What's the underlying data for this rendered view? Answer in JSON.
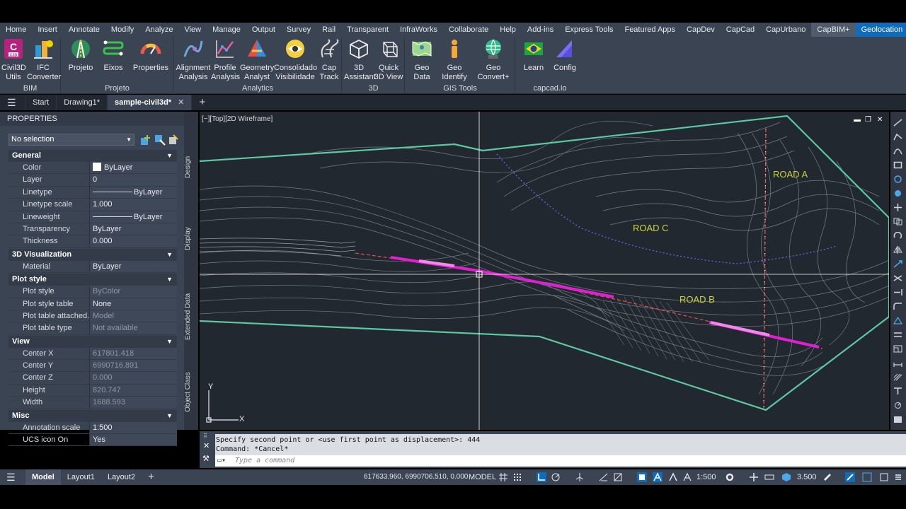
{
  "menus": [
    "Home",
    "Insert",
    "Annotate",
    "Modify",
    "Analyze",
    "View",
    "Manage",
    "Output",
    "Survey",
    "Rail",
    "Transparent",
    "InfraWorks",
    "Collaborate",
    "Help",
    "Add-ins",
    "Express Tools",
    "Featured Apps",
    "CapDev",
    "CapCad",
    "CapUrbano",
    "CapBIM+",
    "Geolocation"
  ],
  "ribbon": {
    "groups": {
      "bim": "BIM",
      "projeto": "Projeto",
      "analytics": "Analytics",
      "d3": "3D",
      "gis": "GIS Tools",
      "capcad": "capcad.io"
    },
    "buttons": {
      "civil3d": "Civil3D Utils",
      "civil3d_l1": "Civil3D",
      "civil3d_l2": "Utils",
      "ifc_l1": "IFC",
      "ifc_l2": "Converter",
      "projeto": "Projeto",
      "eixos": "Eixos",
      "properties": "Properties",
      "alignment_l1": "Alignment",
      "alignment_l2": "Analysis",
      "profile_l1": "Profile",
      "profile_l2": "Analysis",
      "geometry_l1": "Geometry",
      "geometry_l2": "Analyst",
      "consolidado_l1": "Consolidado",
      "consolidado_l2": "Visibilidade",
      "cap_l1": "Cap",
      "cap_l2": "Track",
      "assistant_l1": "3D",
      "assistant_l2": "Assistant",
      "quick_l1": "Quick",
      "quick_l2": "3D View",
      "geodata_l1": "Geo",
      "geodata_l2": "Data",
      "geoidentify_l1": "Geo",
      "geoidentify_l2": "Identify",
      "geoconvert_l1": "Geo",
      "geoconvert_l2": "Convert+",
      "learn": "Learn",
      "config": "Config",
      "c3d_badge": "C3D"
    }
  },
  "doc_tabs": {
    "start": "Start",
    "drawing1": "Drawing1*",
    "sample": "sample-civil3d*"
  },
  "properties": {
    "title": "PROPERTIES",
    "selection": "No selection",
    "sections": {
      "general": "General",
      "viz": "3D Visualization",
      "plot": "Plot style",
      "view": "View",
      "misc": "Misc"
    },
    "general": {
      "color_k": "Color",
      "color_v": "ByLayer",
      "layer_k": "Layer",
      "layer_v": "0",
      "linetype_k": "Linetype",
      "linetype_v": "ByLayer",
      "ltscale_k": "Linetype scale",
      "ltscale_v": "1.000",
      "lweight_k": "Lineweight",
      "lweight_v": "ByLayer",
      "transp_k": "Transparency",
      "transp_v": "ByLayer",
      "thick_k": "Thickness",
      "thick_v": "0.000"
    },
    "viz": {
      "material_k": "Material",
      "material_v": "ByLayer"
    },
    "plot": {
      "style_k": "Plot style",
      "style_v": "ByColor",
      "table_k": "Plot style table",
      "table_v": "None",
      "attached_k": "Plot table attached...",
      "attached_v": "Model",
      "type_k": "Plot table type",
      "type_v": "Not available"
    },
    "view": {
      "cx_k": "Center X",
      "cx_v": "617801.418",
      "cy_k": "Center Y",
      "cy_v": "6990716.891",
      "cz_k": "Center Z",
      "cz_v": "0.000",
      "h_k": "Height",
      "h_v": "820.747",
      "w_k": "Width",
      "w_v": "1688.593"
    },
    "misc": {
      "ann_k": "Annotation scale",
      "ann_v": "1:500",
      "ucs_k": "UCS icon On",
      "ucs_v": "Yes"
    }
  },
  "side_tabs": {
    "design": "Design",
    "display": "Display",
    "extended": "Extended Data",
    "object": "Object Class"
  },
  "viewport": {
    "label": "[−][Top][2D Wireframe]",
    "road_a": "ROAD  A",
    "road_b": "ROAD  B",
    "road_c": "ROAD  C",
    "axis_x": "X",
    "axis_y": "Y"
  },
  "command": {
    "line1": "Specify second point or <use first point as displacement>: 444",
    "line2": "Command: *Cancel*",
    "placeholder": "Type a command"
  },
  "layouts": {
    "model": "Model",
    "layout1": "Layout1",
    "layout2": "Layout2"
  },
  "status": {
    "coords": "617633.960, 6990706.510, 0.000",
    "model": "MODEL",
    "scale": "1:500",
    "precision": "3.500"
  },
  "colors": {
    "boundary": "#5ec7a4",
    "highlight": "#e020d0",
    "road_label": "#c9d43a",
    "contour": "#9aa1ab"
  }
}
